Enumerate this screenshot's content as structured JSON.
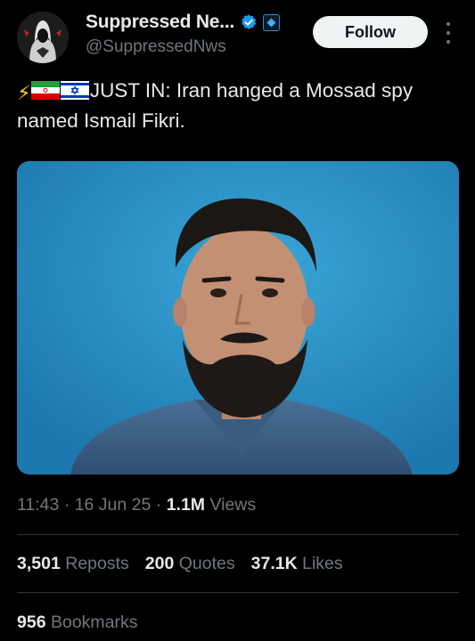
{
  "author": {
    "display_name": "Suppressed Ne...",
    "handle": "@SuppressedNws",
    "verified_icon": "verified-badge-icon",
    "affiliate_icon": "affiliate-badge-icon"
  },
  "actions": {
    "follow_label": "Follow",
    "more_icon": "more-vertical-icon"
  },
  "tweet": {
    "lead_emoji": "⚡",
    "text": "JUST IN: Iran hanged a Mossad spy named Ismail Fikri."
  },
  "meta": {
    "time": "11:43",
    "separator": " · ",
    "date": "16 Jun 25",
    "views_count": "1.1M",
    "views_label": " Views"
  },
  "stats": {
    "reposts_count": "3,501",
    "reposts_label": "Reposts",
    "quotes_count": "200",
    "quotes_label": "Quotes",
    "likes_count": "37.1K",
    "likes_label": "Likes",
    "bookmarks_count": "956",
    "bookmarks_label": "Bookmarks"
  },
  "colors": {
    "background": "#000000",
    "text": "#e7e9ea",
    "muted": "#71767b",
    "verified": "#1d9bf0",
    "photo_background": "#2387c0"
  }
}
